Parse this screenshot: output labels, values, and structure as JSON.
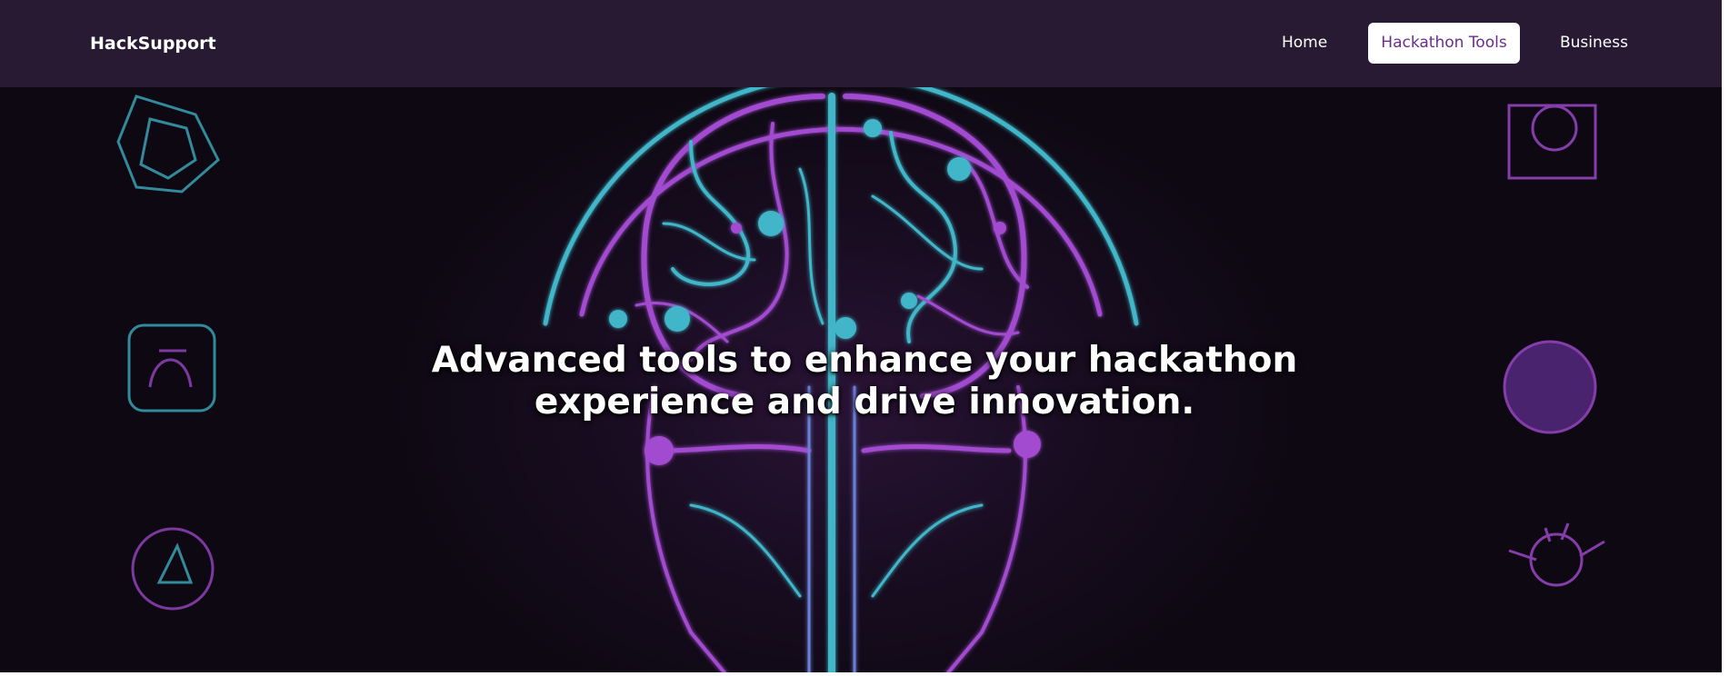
{
  "navbar": {
    "brand": "HackSupport",
    "links": [
      {
        "label": "Home"
      },
      {
        "label": "Hackathon Tools",
        "active": true
      },
      {
        "label": "Business"
      }
    ]
  },
  "hero": {
    "title_line1": "Advanced tools to enhance your hackathon",
    "title_line2": "experience and drive innovation."
  },
  "colors": {
    "navbar_bg": "#281a33",
    "active_tab_text": "#6a2c91",
    "glow_teal": "#3fb6c8",
    "glow_purple": "#a24bd1"
  }
}
